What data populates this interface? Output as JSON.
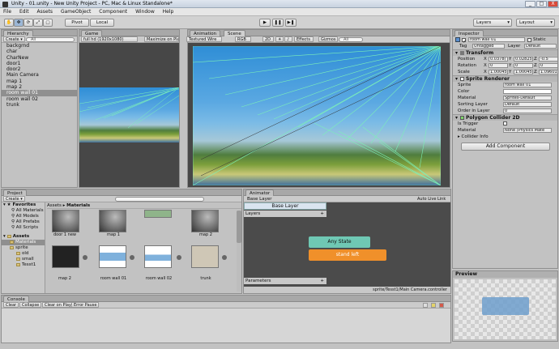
{
  "window": {
    "title": "Unity - 01.unity - New Unity Project - PC, Mac & Linux Standalone*",
    "min": "_",
    "max": "□",
    "close": "X"
  },
  "menu": [
    "File",
    "Edit",
    "Assets",
    "GameObject",
    "Component",
    "Window",
    "Help"
  ],
  "toolbar": {
    "pivot": "Pivot",
    "local": "Local",
    "play": "▶",
    "pause": "❚❚",
    "step": "▶❚",
    "layers": "Layers",
    "layout": "Layout",
    "dropdown": "▾"
  },
  "hierarchy": {
    "tab": "Hierarchy",
    "create": "Create ▾",
    "search": "All",
    "items": [
      "backgrnd",
      "char",
      "CharNew",
      "door1",
      "door2",
      "Main Camera",
      "map 1",
      "map 2",
      "room wall 01",
      "room wall 02",
      "trunk"
    ],
    "selected_index": 8
  },
  "game": {
    "tab": "Game",
    "resolution": "full hd (1920x1080)",
    "maximize": "Maximize on Play",
    "stats": "Stats",
    "gizmos": "Gizmos ▾"
  },
  "scene": {
    "tabs": [
      "Animation",
      "Scene"
    ],
    "shading": "Textured Wire",
    "rgb": "RGB",
    "mode2d": "2D",
    "effects": "Effects ▾",
    "gizmos": "Gizmos ▾",
    "search": "All"
  },
  "inspector": {
    "tab": "Inspector",
    "name": "room wall 01",
    "static": "Static",
    "tag_label": "Tag",
    "tag": "Untagged",
    "layer_label": "Layer",
    "layer": "Default",
    "transform": {
      "title": "Transform",
      "rows": [
        {
          "label": "Position",
          "x": "0.0378(",
          "y": "0.02825",
          "z": "-0.5"
        },
        {
          "label": "Rotation",
          "x": "0",
          "y": "0",
          "z": "0"
        },
        {
          "label": "Scale",
          "x": "1.00045",
          "y": "1.00045",
          "z": "1.09601"
        }
      ]
    },
    "sprite_renderer": {
      "title": "Sprite Renderer",
      "sprite_label": "Sprite",
      "sprite": "room wall 01",
      "color_label": "Color",
      "material_label": "Material",
      "material": "Sprites-Default",
      "sorting_label": "Sorting Layer",
      "sorting": "Default",
      "order_label": "Order in Layer",
      "order": "0"
    },
    "polygon": {
      "title": "Polygon Collider 2D",
      "trigger_label": "Is Trigger",
      "material_label": "Material",
      "material": "None (Physics Mate",
      "info": "Collider Info"
    },
    "add_component": "Add Component",
    "axes": [
      "X",
      "Y",
      "Z"
    ]
  },
  "project": {
    "tab": "Project",
    "create": "Create ▾",
    "favorites_title": "Favorites",
    "favorites": [
      "All Materials",
      "All Models",
      "All Prefabs",
      "All Scripts"
    ],
    "assets_title": "Assets",
    "asset_folders": [
      {
        "label": "Materials",
        "level": 1,
        "selected": true
      },
      {
        "label": "sprite",
        "level": 1
      },
      {
        "label": "old",
        "level": 2
      },
      {
        "label": "small",
        "level": 2
      },
      {
        "label": "Tesst1",
        "level": 2
      }
    ],
    "breadcrumb": [
      "Assets",
      "Materials"
    ],
    "row1": [
      "door 1 new",
      "map 1",
      "",
      "map 2"
    ],
    "row2": [
      "map 2",
      "room wall 01",
      "room wall 02",
      "trunk"
    ]
  },
  "animator": {
    "tab": "Animator",
    "base_layer": "Base Layer",
    "live_link": "Auto Live Link",
    "layers": "Layers",
    "parameters": "Parameters",
    "any_state": "Any State",
    "default_state": "stand left",
    "footer": "sprite/Tesst1/Main Camera.controller",
    "plus": "+"
  },
  "preview": {
    "title": "Preview"
  },
  "console": {
    "tab": "Console",
    "buttons": [
      "Clear",
      "Collapse",
      "Clear on Play",
      "Error Pause"
    ]
  },
  "colors": {
    "selection": "#7fa6cf",
    "any_state": "#6fc8b4",
    "default_state": "#f0902a",
    "wire": "#7cf0b8"
  }
}
